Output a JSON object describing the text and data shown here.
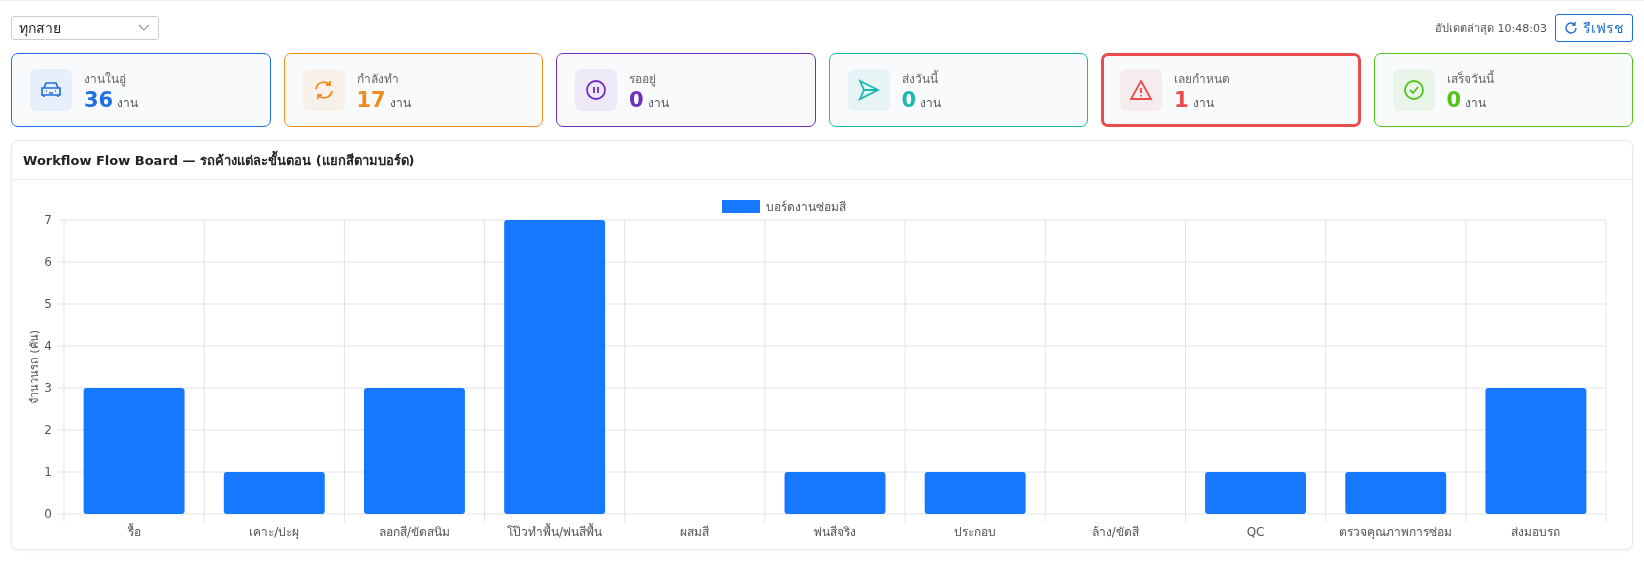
{
  "filter": {
    "value": "ทุกสาย"
  },
  "updated": "อัปเดตล่าสุด 10:48:03",
  "refresh_button": "รีเฟรช",
  "stats": [
    {
      "kind": "car",
      "label": "งานในอู่",
      "value": "36",
      "unit": "งาน",
      "color": "#1f6fe0",
      "alert": false
    },
    {
      "kind": "sync",
      "label": "กำลังทำ",
      "value": "17",
      "unit": "งาน",
      "color": "#f08c1c",
      "alert": false
    },
    {
      "kind": "pause",
      "label": "รออยู่",
      "value": "0",
      "unit": "งาน",
      "color": "#6f2cc0",
      "alert": false
    },
    {
      "kind": "send",
      "label": "ส่งวันนี้",
      "value": "0",
      "unit": "งาน",
      "color": "#1cb8b0",
      "alert": false
    },
    {
      "kind": "warning",
      "label": "เลยกำหนด",
      "value": "1",
      "unit": "งาน",
      "color": "#e84c4c",
      "alert": true
    },
    {
      "kind": "check",
      "label": "เสร็จวันนี้",
      "value": "0",
      "unit": "งาน",
      "color": "#52c41a",
      "alert": false
    }
  ],
  "chart_panel": {
    "title": "Workflow Flow Board — รถค้างแต่ละขั้นตอน (แยกสีตามบอร์ด)",
    "chart_data": {
      "type": "bar",
      "ylabel": "จำนวนรถ (คัน)",
      "categories": [
        "รื้อ",
        "เคาะ/ปะผุ",
        "ลอกสี/ขัดสนิม",
        "โป๊วทำพื้น/พ่นสีพื้น",
        "ผสมสี",
        "พ่นสีจริง",
        "ประกอบ",
        "ล้าง/ขัดสี",
        "QC",
        "ตรวจคุณภาพการซ่อม",
        "ส่งมอบรถ"
      ],
      "series": [
        {
          "name": "บอร์ดงานซ่อมสี",
          "color": "#1677ff",
          "values": [
            3,
            1,
            3,
            7,
            0,
            1,
            1,
            0,
            1,
            1,
            3
          ]
        }
      ],
      "grid": true,
      "ylim": [
        0,
        7
      ],
      "yticks": [
        0,
        1,
        2,
        3,
        4,
        5,
        6,
        7
      ]
    }
  }
}
